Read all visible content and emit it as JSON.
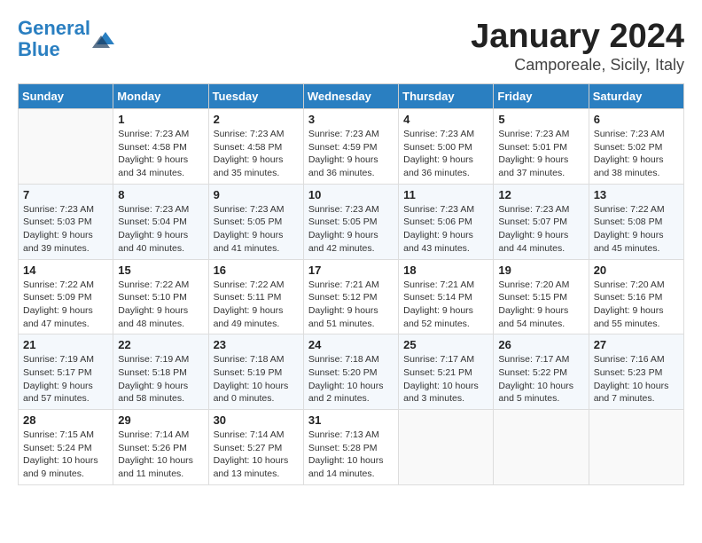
{
  "header": {
    "logo_line1": "General",
    "logo_line2": "Blue",
    "month": "January 2024",
    "location": "Camporeale, Sicily, Italy"
  },
  "days_of_week": [
    "Sunday",
    "Monday",
    "Tuesday",
    "Wednesday",
    "Thursday",
    "Friday",
    "Saturday"
  ],
  "weeks": [
    [
      {
        "day": "",
        "sunrise": "",
        "sunset": "",
        "daylight": ""
      },
      {
        "day": "1",
        "sunrise": "Sunrise: 7:23 AM",
        "sunset": "Sunset: 4:58 PM",
        "daylight": "Daylight: 9 hours and 34 minutes."
      },
      {
        "day": "2",
        "sunrise": "Sunrise: 7:23 AM",
        "sunset": "Sunset: 4:58 PM",
        "daylight": "Daylight: 9 hours and 35 minutes."
      },
      {
        "day": "3",
        "sunrise": "Sunrise: 7:23 AM",
        "sunset": "Sunset: 4:59 PM",
        "daylight": "Daylight: 9 hours and 36 minutes."
      },
      {
        "day": "4",
        "sunrise": "Sunrise: 7:23 AM",
        "sunset": "Sunset: 5:00 PM",
        "daylight": "Daylight: 9 hours and 36 minutes."
      },
      {
        "day": "5",
        "sunrise": "Sunrise: 7:23 AM",
        "sunset": "Sunset: 5:01 PM",
        "daylight": "Daylight: 9 hours and 37 minutes."
      },
      {
        "day": "6",
        "sunrise": "Sunrise: 7:23 AM",
        "sunset": "Sunset: 5:02 PM",
        "daylight": "Daylight: 9 hours and 38 minutes."
      }
    ],
    [
      {
        "day": "7",
        "sunrise": "Sunrise: 7:23 AM",
        "sunset": "Sunset: 5:03 PM",
        "daylight": "Daylight: 9 hours and 39 minutes."
      },
      {
        "day": "8",
        "sunrise": "Sunrise: 7:23 AM",
        "sunset": "Sunset: 5:04 PM",
        "daylight": "Daylight: 9 hours and 40 minutes."
      },
      {
        "day": "9",
        "sunrise": "Sunrise: 7:23 AM",
        "sunset": "Sunset: 5:05 PM",
        "daylight": "Daylight: 9 hours and 41 minutes."
      },
      {
        "day": "10",
        "sunrise": "Sunrise: 7:23 AM",
        "sunset": "Sunset: 5:05 PM",
        "daylight": "Daylight: 9 hours and 42 minutes."
      },
      {
        "day": "11",
        "sunrise": "Sunrise: 7:23 AM",
        "sunset": "Sunset: 5:06 PM",
        "daylight": "Daylight: 9 hours and 43 minutes."
      },
      {
        "day": "12",
        "sunrise": "Sunrise: 7:23 AM",
        "sunset": "Sunset: 5:07 PM",
        "daylight": "Daylight: 9 hours and 44 minutes."
      },
      {
        "day": "13",
        "sunrise": "Sunrise: 7:22 AM",
        "sunset": "Sunset: 5:08 PM",
        "daylight": "Daylight: 9 hours and 45 minutes."
      }
    ],
    [
      {
        "day": "14",
        "sunrise": "Sunrise: 7:22 AM",
        "sunset": "Sunset: 5:09 PM",
        "daylight": "Daylight: 9 hours and 47 minutes."
      },
      {
        "day": "15",
        "sunrise": "Sunrise: 7:22 AM",
        "sunset": "Sunset: 5:10 PM",
        "daylight": "Daylight: 9 hours and 48 minutes."
      },
      {
        "day": "16",
        "sunrise": "Sunrise: 7:22 AM",
        "sunset": "Sunset: 5:11 PM",
        "daylight": "Daylight: 9 hours and 49 minutes."
      },
      {
        "day": "17",
        "sunrise": "Sunrise: 7:21 AM",
        "sunset": "Sunset: 5:12 PM",
        "daylight": "Daylight: 9 hours and 51 minutes."
      },
      {
        "day": "18",
        "sunrise": "Sunrise: 7:21 AM",
        "sunset": "Sunset: 5:14 PM",
        "daylight": "Daylight: 9 hours and 52 minutes."
      },
      {
        "day": "19",
        "sunrise": "Sunrise: 7:20 AM",
        "sunset": "Sunset: 5:15 PM",
        "daylight": "Daylight: 9 hours and 54 minutes."
      },
      {
        "day": "20",
        "sunrise": "Sunrise: 7:20 AM",
        "sunset": "Sunset: 5:16 PM",
        "daylight": "Daylight: 9 hours and 55 minutes."
      }
    ],
    [
      {
        "day": "21",
        "sunrise": "Sunrise: 7:19 AM",
        "sunset": "Sunset: 5:17 PM",
        "daylight": "Daylight: 9 hours and 57 minutes."
      },
      {
        "day": "22",
        "sunrise": "Sunrise: 7:19 AM",
        "sunset": "Sunset: 5:18 PM",
        "daylight": "Daylight: 9 hours and 58 minutes."
      },
      {
        "day": "23",
        "sunrise": "Sunrise: 7:18 AM",
        "sunset": "Sunset: 5:19 PM",
        "daylight": "Daylight: 10 hours and 0 minutes."
      },
      {
        "day": "24",
        "sunrise": "Sunrise: 7:18 AM",
        "sunset": "Sunset: 5:20 PM",
        "daylight": "Daylight: 10 hours and 2 minutes."
      },
      {
        "day": "25",
        "sunrise": "Sunrise: 7:17 AM",
        "sunset": "Sunset: 5:21 PM",
        "daylight": "Daylight: 10 hours and 3 minutes."
      },
      {
        "day": "26",
        "sunrise": "Sunrise: 7:17 AM",
        "sunset": "Sunset: 5:22 PM",
        "daylight": "Daylight: 10 hours and 5 minutes."
      },
      {
        "day": "27",
        "sunrise": "Sunrise: 7:16 AM",
        "sunset": "Sunset: 5:23 PM",
        "daylight": "Daylight: 10 hours and 7 minutes."
      }
    ],
    [
      {
        "day": "28",
        "sunrise": "Sunrise: 7:15 AM",
        "sunset": "Sunset: 5:24 PM",
        "daylight": "Daylight: 10 hours and 9 minutes."
      },
      {
        "day": "29",
        "sunrise": "Sunrise: 7:14 AM",
        "sunset": "Sunset: 5:26 PM",
        "daylight": "Daylight: 10 hours and 11 minutes."
      },
      {
        "day": "30",
        "sunrise": "Sunrise: 7:14 AM",
        "sunset": "Sunset: 5:27 PM",
        "daylight": "Daylight: 10 hours and 13 minutes."
      },
      {
        "day": "31",
        "sunrise": "Sunrise: 7:13 AM",
        "sunset": "Sunset: 5:28 PM",
        "daylight": "Daylight: 10 hours and 14 minutes."
      },
      {
        "day": "",
        "sunrise": "",
        "sunset": "",
        "daylight": ""
      },
      {
        "day": "",
        "sunrise": "",
        "sunset": "",
        "daylight": ""
      },
      {
        "day": "",
        "sunrise": "",
        "sunset": "",
        "daylight": ""
      }
    ]
  ]
}
